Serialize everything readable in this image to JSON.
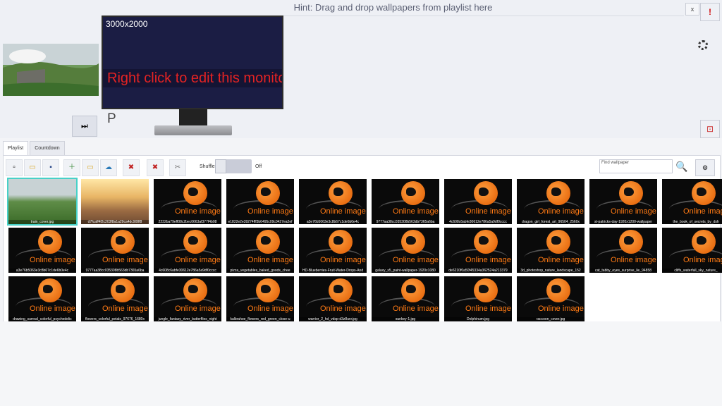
{
  "header": {
    "hint": "Hint: Drag and drop wallpapers from playlist here",
    "close_label": "x",
    "alert_label": "!",
    "layout_label": "⊡"
  },
  "monitor": {
    "resolution": "3000x2000",
    "edit_text": "Right click to edit this monitor",
    "screen_letter": "P"
  },
  "controls": {
    "next_label": "⏭"
  },
  "tabs": [
    "Playlist",
    "Countdown"
  ],
  "toolbar": {
    "shuffle_label": "Shuffle",
    "shuffle_state": "Off",
    "search_placeholder": "Find wallpaper",
    "search_icon": "🔍",
    "settings_icon": "⚙"
  },
  "overlay_text": "Online image",
  "items": [
    {
      "name": "train_cover.jpg",
      "type": "photo-train"
    },
    {
      "name": "d7fcaff4f2c203f8a1a29ca4dc908f8",
      "type": "photo-sunset"
    },
    {
      "name": "2232ba79eff08c2bec0663af377f4b08",
      "type": "online"
    },
    {
      "name": "e1822e2e39274fff3b6495c09c0427ea2ef",
      "type": "online"
    },
    {
      "name": "a3e76b5063e3c8b67c1de6b0e4c",
      "type": "online"
    },
    {
      "name": "9777aa38cc035308b563db7365a6ba",
      "type": "online"
    },
    {
      "name": "4c608c6abfe30612e786a5a9df0cccc",
      "type": "online"
    },
    {
      "name": "dragon_girl_forest_art_96504_2560x",
      "type": "online"
    },
    {
      "name": "st-patricks-day-1920x1200-wallpaper",
      "type": "online"
    },
    {
      "name": "the_book_of_secrets_by_dsh",
      "type": "online"
    },
    {
      "name": "a3e76b5063e3c8b67c1de6b0e4c",
      "type": "online"
    },
    {
      "name": "9777aa38cc035308b563db7365a6ba",
      "type": "online"
    },
    {
      "name": "4c608c6abfe30612e786a5a9df0cccc",
      "type": "online"
    },
    {
      "name": "pizza_vegetables_baked_goods_chee",
      "type": "online"
    },
    {
      "name": "HD-Blueberries-Fruit-Water-Drops-And",
      "type": "online"
    },
    {
      "name": "galaxy_s5_paint-wallpaper-1920x1080",
      "type": "online"
    },
    {
      "name": "de6210f0a50f45334a362524a213379",
      "type": "online"
    },
    {
      "name": "3d_photoshop_nature_landscape_152",
      "type": "online"
    },
    {
      "name": "cat_tabby_eyes_surprise_lie_94858",
      "type": "online"
    },
    {
      "name": "cliffs_waterfall_sky_nature_",
      "type": "online"
    },
    {
      "name": "drawing_surreal_colorful_psychedelic",
      "type": "online"
    },
    {
      "name": "flowers_colorful_petals_97676_1680x",
      "type": "online"
    },
    {
      "name": "jungle_fantasy_river_butterflies_night",
      "type": "online"
    },
    {
      "name": "kalbrahoe_flowers_red_green_close-u",
      "type": "online"
    },
    {
      "name": "warrior_2_hd_vdsp-d3z8urv.jpg",
      "type": "online"
    },
    {
      "name": "sunkey-1.jpg",
      "type": "online"
    },
    {
      "name": "Dolphinum.jpg",
      "type": "online"
    },
    {
      "name": "raccoon_cover.jpg",
      "type": "online"
    }
  ],
  "colors": {
    "selected_outline": "#47d1c8",
    "overlay_orange": "#ff7a14",
    "edit_text": "#e52323",
    "monitor_bg": "#1b1d44"
  }
}
